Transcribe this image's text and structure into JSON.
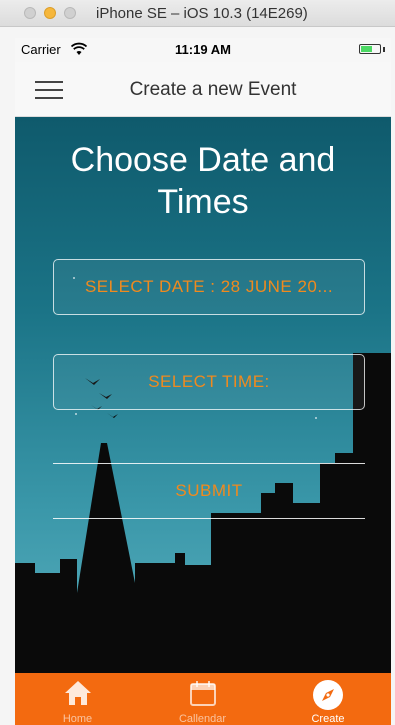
{
  "window": {
    "title": "iPhone SE – iOS 10.3 (14E269)"
  },
  "status_bar": {
    "carrier": "Carrier",
    "time": "11:19 AM",
    "battery_level": 0.6
  },
  "nav": {
    "title": "Create a new Event",
    "menu_icon": "hamburger-menu-icon"
  },
  "main": {
    "heading": "Choose Date and Times",
    "select_date_label": "SELECT DATE : 28 JUNE 20...",
    "select_time_label": "SELECT TIME:",
    "submit_label": "SUBMIT"
  },
  "tabs": [
    {
      "label": "Home",
      "icon": "home-icon",
      "active": false
    },
    {
      "label": "Callendar",
      "icon": "calendar-icon",
      "active": false
    },
    {
      "label": "Create",
      "icon": "compass-icon",
      "active": true
    }
  ],
  "colors": {
    "accent": "#f08a1e",
    "tab_bar": "#f36a10",
    "background_top": "#0f5a6c",
    "background_bottom": "#5ab0bf"
  }
}
